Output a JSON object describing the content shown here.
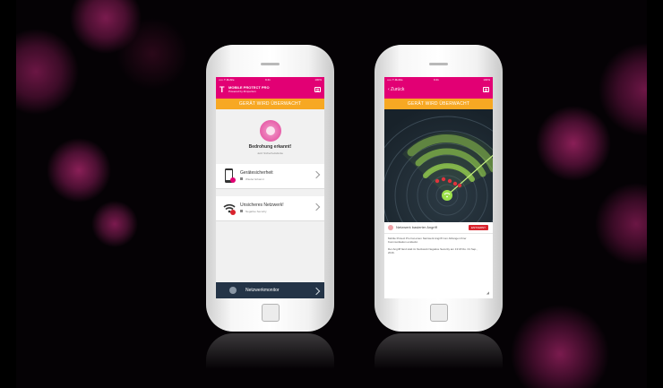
{
  "colors": {
    "magenta": "#e20074",
    "orange": "#f7a823",
    "navy": "#243447",
    "radar_green": "#9be04a"
  },
  "phone_left": {
    "status": {
      "carrier": "••••• T-Mobile",
      "time": "9:41",
      "battery": "100%"
    },
    "header": {
      "logo": "T",
      "title": "MOBILE PROTECT PRO",
      "subtitle": "Powered by Zimperium",
      "menu_icon": "menu-icon"
    },
    "banner": "GERÄT WIRD ÜBERWACHT",
    "threat": {
      "title": "Bedrohung erkannt!",
      "subtitle": "Jetzt Sicherheitslücke",
      "icon": "shield-alert-icon"
    },
    "items": [
      {
        "title": "Gerätesicherheit",
        "status": "Wieder Erkannt",
        "icon": "phone-check-icon"
      },
      {
        "title": "Unsicheres Netzwerk!",
        "status": "Negative Security",
        "icon": "wifi-alert-icon"
      }
    ],
    "footer": {
      "label": "Netzwerkmonitor",
      "icon": "gauge-icon"
    }
  },
  "phone_right": {
    "status": {
      "carrier": "••••• T-Mobile",
      "time": "9:41",
      "battery": "100%"
    },
    "header": {
      "back": "‹ Zurück",
      "menu_icon": "menu-icon"
    },
    "banner": "GERÄT WIRD ÜBERWACHT",
    "alert": {
      "title": "Netzwerk basierter Angriff",
      "badge": "ENTFERNT",
      "icon": "alert-dot-icon"
    },
    "paragraph1": "Mobile Protect Pro hat einen Netzwerk Angriff zum Abfangen Ihrer Kommunikation entdeckt.",
    "paragraph2": "Der Angriff fand statt im Netzwerk Negative Security am 13:18 Do. 01 Sep., 2016."
  }
}
